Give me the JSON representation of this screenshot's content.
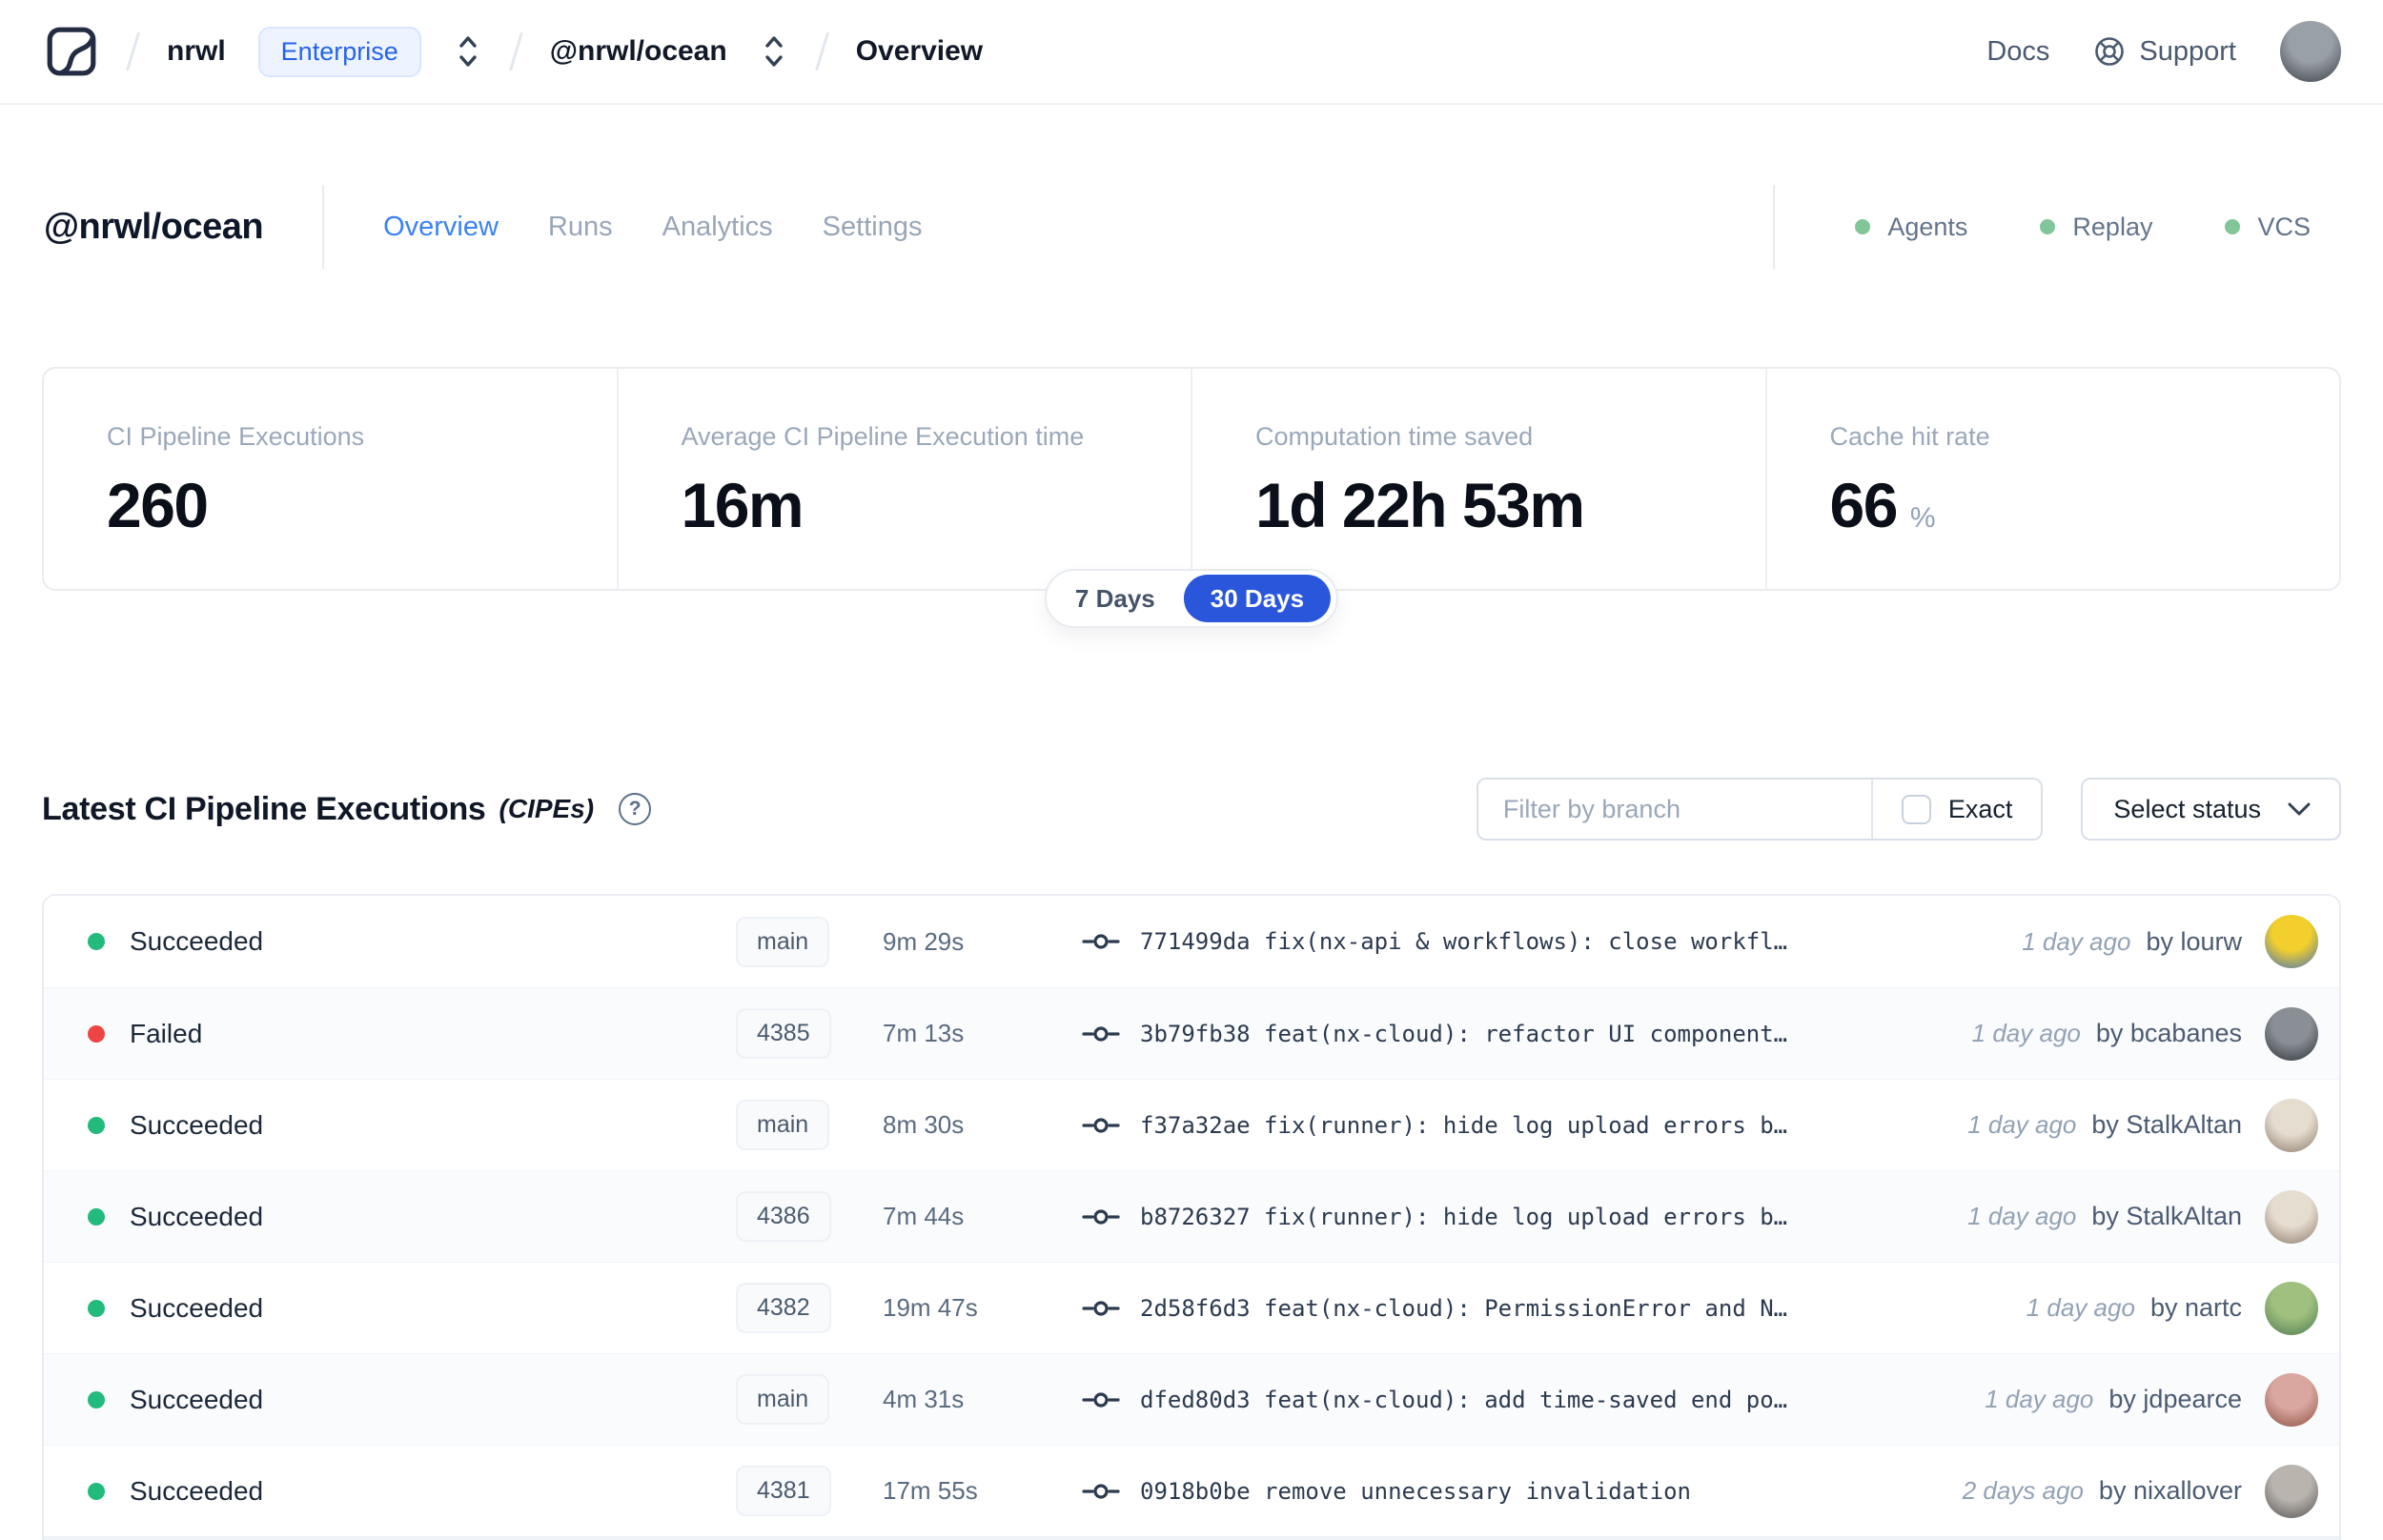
{
  "colors": {
    "accent_blue": "#3b82f6",
    "toggle_blue": "#2a56dc",
    "enterprise_blue": "#2563eb",
    "success_green": "#23ba7d",
    "failed_red": "#ee4444",
    "header_dot_green": "#80c698",
    "border_gray": "#e9ecf1"
  },
  "icons": {
    "logo": "nx-cloud-logo",
    "selector": "chevron-up-down",
    "slash": "breadcrumb-slash",
    "support": "lifebuoy-icon",
    "help": "question-circle-icon",
    "commit": "git-commit-icon",
    "dropdown": "chevron-down-icon",
    "checkbox": "checkbox-unchecked"
  },
  "navbar": {
    "breadcrumb": {
      "org": "nrwl",
      "org_badge": "Enterprise",
      "workspace": "@nrwl/ocean",
      "page": "Overview"
    },
    "docs_label": "Docs",
    "support_label": "Support",
    "user_avatar": [
      "#9aa0a8",
      "#3a3f47"
    ]
  },
  "workspace_header": {
    "title": "@nrwl/ocean",
    "tabs": [
      {
        "label": "Overview",
        "active": true
      },
      {
        "label": "Runs",
        "active": false
      },
      {
        "label": "Analytics",
        "active": false
      },
      {
        "label": "Settings",
        "active": false
      }
    ],
    "statuses": [
      {
        "label": "Agents"
      },
      {
        "label": "Replay"
      },
      {
        "label": "VCS"
      }
    ]
  },
  "stats": {
    "cards": [
      {
        "label": "CI Pipeline Executions",
        "value": "260",
        "suffix": ""
      },
      {
        "label": "Average CI Pipeline Execution time",
        "value": "16m",
        "suffix": ""
      },
      {
        "label": "Computation time saved",
        "value": "1d 22h 53m",
        "suffix": ""
      },
      {
        "label": "Cache hit rate",
        "value": "66",
        "suffix": "%"
      }
    ],
    "period_toggle": {
      "options": [
        "7 Days",
        "30 Days"
      ],
      "selected": "30 Days"
    }
  },
  "cipe_section": {
    "title": "Latest CI Pipeline Executions",
    "subtitle": "(CIPEs)",
    "filter": {
      "placeholder": "Filter by branch",
      "exact_label": "Exact"
    },
    "status_dropdown_label": "Select status",
    "rows": [
      {
        "status": "Succeeded",
        "status_color": "green",
        "branch": "main",
        "duration": "9m 29s",
        "commit_hash": "771499da",
        "commit_message": "fix(nx-api & workflows): close workfl…",
        "time_ago": "1 day ago",
        "author": "by lourw",
        "avatar": [
          "#f2cf2c",
          "#4673b8"
        ]
      },
      {
        "status": "Failed",
        "status_color": "red",
        "branch": "4385",
        "duration": "7m 13s",
        "commit_hash": "3b79fb38",
        "commit_message": "feat(nx-cloud): refactor UI component…",
        "time_ago": "1 day ago",
        "author": "by bcabanes",
        "avatar": [
          "#8a8f96",
          "#2e3138"
        ]
      },
      {
        "status": "Succeeded",
        "status_color": "green",
        "branch": "main",
        "duration": "8m 30s",
        "commit_hash": "f37a32ae",
        "commit_message": "fix(runner): hide log upload errors b…",
        "time_ago": "1 day ago",
        "author": "by StalkAltan",
        "avatar": [
          "#e6ddd1",
          "#8c7b68"
        ]
      },
      {
        "status": "Succeeded",
        "status_color": "green",
        "branch": "4386",
        "duration": "7m 44s",
        "commit_hash": "b8726327",
        "commit_message": "fix(runner): hide log upload errors b…",
        "time_ago": "1 day ago",
        "author": "by StalkAltan",
        "avatar": [
          "#e6ddd1",
          "#8c7b68"
        ]
      },
      {
        "status": "Succeeded",
        "status_color": "green",
        "branch": "4382",
        "duration": "19m 47s",
        "commit_hash": "2d58f6d3",
        "commit_message": "feat(nx-cloud): PermissionError and N…",
        "time_ago": "1 day ago",
        "author": "by nartc",
        "avatar": [
          "#9fc07e",
          "#4e7a52"
        ]
      },
      {
        "status": "Succeeded",
        "status_color": "green",
        "branch": "main",
        "duration": "4m 31s",
        "commit_hash": "dfed80d3",
        "commit_message": "feat(nx-cloud): add time-saved end po…",
        "time_ago": "1 day ago",
        "author": "by jdpearce",
        "avatar": [
          "#d9a7a0",
          "#8c4f3f"
        ]
      },
      {
        "status": "Succeeded",
        "status_color": "green",
        "branch": "4381",
        "duration": "17m 55s",
        "commit_hash": "0918b0be",
        "commit_message": "remove unnecessary invalidation",
        "time_ago": "2 days ago",
        "author": "by nixallover",
        "avatar": [
          "#b9b4ae",
          "#565353"
        ]
      }
    ]
  }
}
